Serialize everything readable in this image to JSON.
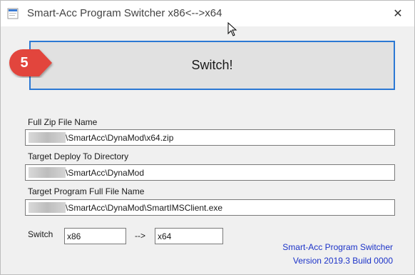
{
  "window": {
    "title": "Smart-Acc Program Switcher x86<-->x64",
    "close_glyph": "✕"
  },
  "step_badge": {
    "number": "5",
    "color": "#e2453c"
  },
  "switch_button": {
    "label": "Switch!"
  },
  "fields": {
    "zip": {
      "label": "Full Zip File Name",
      "value": "\\SmartAcc\\DynaMod\\x64.zip"
    },
    "deploy": {
      "label": "Target Deploy To Directory",
      "value": "\\SmartAcc\\DynaMod"
    },
    "program": {
      "label": "Target Program Full File Name",
      "value": "\\SmartAcc\\DynaMod\\SmartIMSClient.exe"
    }
  },
  "switch_row": {
    "label": "Switch",
    "from_value": "x86",
    "arrow": "-->",
    "to_value": "x64"
  },
  "footer": {
    "app_name": "Smart-Acc Program Switcher",
    "version": "Version 2019.3 Build 0000",
    "color": "#1c33c8"
  }
}
